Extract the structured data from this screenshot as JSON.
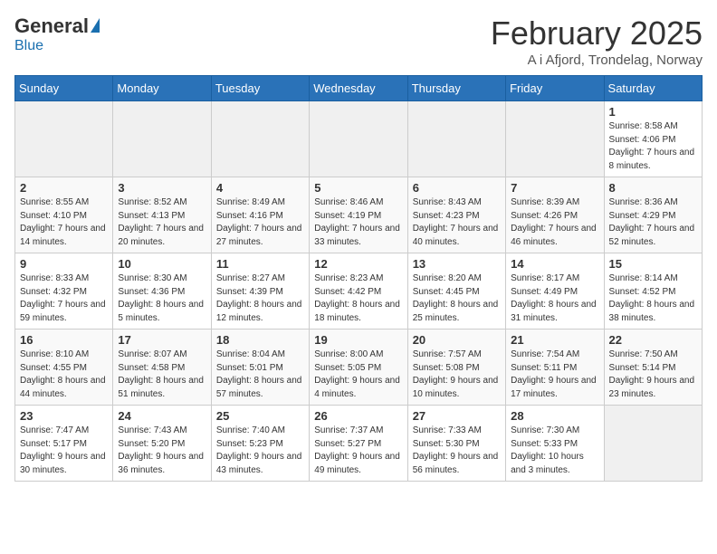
{
  "header": {
    "logo_general": "General",
    "logo_blue": "Blue",
    "month_title": "February 2025",
    "location": "A i Afjord, Trondelag, Norway"
  },
  "days_of_week": [
    "Sunday",
    "Monday",
    "Tuesday",
    "Wednesday",
    "Thursday",
    "Friday",
    "Saturday"
  ],
  "weeks": [
    [
      {
        "day": "",
        "info": ""
      },
      {
        "day": "",
        "info": ""
      },
      {
        "day": "",
        "info": ""
      },
      {
        "day": "",
        "info": ""
      },
      {
        "day": "",
        "info": ""
      },
      {
        "day": "",
        "info": ""
      },
      {
        "day": "1",
        "info": "Sunrise: 8:58 AM\nSunset: 4:06 PM\nDaylight: 7 hours and 8 minutes."
      }
    ],
    [
      {
        "day": "2",
        "info": "Sunrise: 8:55 AM\nSunset: 4:10 PM\nDaylight: 7 hours and 14 minutes."
      },
      {
        "day": "3",
        "info": "Sunrise: 8:52 AM\nSunset: 4:13 PM\nDaylight: 7 hours and 20 minutes."
      },
      {
        "day": "4",
        "info": "Sunrise: 8:49 AM\nSunset: 4:16 PM\nDaylight: 7 hours and 27 minutes."
      },
      {
        "day": "5",
        "info": "Sunrise: 8:46 AM\nSunset: 4:19 PM\nDaylight: 7 hours and 33 minutes."
      },
      {
        "day": "6",
        "info": "Sunrise: 8:43 AM\nSunset: 4:23 PM\nDaylight: 7 hours and 40 minutes."
      },
      {
        "day": "7",
        "info": "Sunrise: 8:39 AM\nSunset: 4:26 PM\nDaylight: 7 hours and 46 minutes."
      },
      {
        "day": "8",
        "info": "Sunrise: 8:36 AM\nSunset: 4:29 PM\nDaylight: 7 hours and 52 minutes."
      }
    ],
    [
      {
        "day": "9",
        "info": "Sunrise: 8:33 AM\nSunset: 4:32 PM\nDaylight: 7 hours and 59 minutes."
      },
      {
        "day": "10",
        "info": "Sunrise: 8:30 AM\nSunset: 4:36 PM\nDaylight: 8 hours and 5 minutes."
      },
      {
        "day": "11",
        "info": "Sunrise: 8:27 AM\nSunset: 4:39 PM\nDaylight: 8 hours and 12 minutes."
      },
      {
        "day": "12",
        "info": "Sunrise: 8:23 AM\nSunset: 4:42 PM\nDaylight: 8 hours and 18 minutes."
      },
      {
        "day": "13",
        "info": "Sunrise: 8:20 AM\nSunset: 4:45 PM\nDaylight: 8 hours and 25 minutes."
      },
      {
        "day": "14",
        "info": "Sunrise: 8:17 AM\nSunset: 4:49 PM\nDaylight: 8 hours and 31 minutes."
      },
      {
        "day": "15",
        "info": "Sunrise: 8:14 AM\nSunset: 4:52 PM\nDaylight: 8 hours and 38 minutes."
      }
    ],
    [
      {
        "day": "16",
        "info": "Sunrise: 8:10 AM\nSunset: 4:55 PM\nDaylight: 8 hours and 44 minutes."
      },
      {
        "day": "17",
        "info": "Sunrise: 8:07 AM\nSunset: 4:58 PM\nDaylight: 8 hours and 51 minutes."
      },
      {
        "day": "18",
        "info": "Sunrise: 8:04 AM\nSunset: 5:01 PM\nDaylight: 8 hours and 57 minutes."
      },
      {
        "day": "19",
        "info": "Sunrise: 8:00 AM\nSunset: 5:05 PM\nDaylight: 9 hours and 4 minutes."
      },
      {
        "day": "20",
        "info": "Sunrise: 7:57 AM\nSunset: 5:08 PM\nDaylight: 9 hours and 10 minutes."
      },
      {
        "day": "21",
        "info": "Sunrise: 7:54 AM\nSunset: 5:11 PM\nDaylight: 9 hours and 17 minutes."
      },
      {
        "day": "22",
        "info": "Sunrise: 7:50 AM\nSunset: 5:14 PM\nDaylight: 9 hours and 23 minutes."
      }
    ],
    [
      {
        "day": "23",
        "info": "Sunrise: 7:47 AM\nSunset: 5:17 PM\nDaylight: 9 hours and 30 minutes."
      },
      {
        "day": "24",
        "info": "Sunrise: 7:43 AM\nSunset: 5:20 PM\nDaylight: 9 hours and 36 minutes."
      },
      {
        "day": "25",
        "info": "Sunrise: 7:40 AM\nSunset: 5:23 PM\nDaylight: 9 hours and 43 minutes."
      },
      {
        "day": "26",
        "info": "Sunrise: 7:37 AM\nSunset: 5:27 PM\nDaylight: 9 hours and 49 minutes."
      },
      {
        "day": "27",
        "info": "Sunrise: 7:33 AM\nSunset: 5:30 PM\nDaylight: 9 hours and 56 minutes."
      },
      {
        "day": "28",
        "info": "Sunrise: 7:30 AM\nSunset: 5:33 PM\nDaylight: 10 hours and 3 minutes."
      },
      {
        "day": "",
        "info": ""
      }
    ]
  ]
}
